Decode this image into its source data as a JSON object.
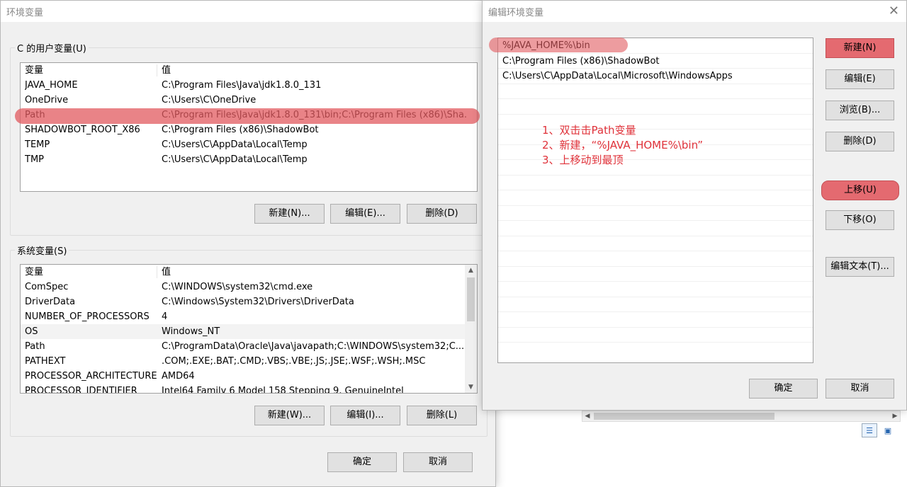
{
  "env_window": {
    "title": "环境变量",
    "user_group_label": "C 的用户变量(U)",
    "system_group_label": "系统变量(S)",
    "col_var": "变量",
    "col_value": "值",
    "user_vars": [
      {
        "name": "JAVA_HOME",
        "value": "C:\\Program Files\\Java\\jdk1.8.0_131"
      },
      {
        "name": "OneDrive",
        "value": "C:\\Users\\C\\OneDrive"
      },
      {
        "name": "Path",
        "value": "C:\\Program Files\\Java\\jdk1.8.0_131\\bin;C:\\Program Files (x86)\\Sha..."
      },
      {
        "name": "SHADOWBOT_ROOT_X86",
        "value": "C:\\Program Files (x86)\\ShadowBot"
      },
      {
        "name": "TEMP",
        "value": "C:\\Users\\C\\AppData\\Local\\Temp"
      },
      {
        "name": "TMP",
        "value": "C:\\Users\\C\\AppData\\Local\\Temp"
      }
    ],
    "system_vars": [
      {
        "name": "ComSpec",
        "value": "C:\\WINDOWS\\system32\\cmd.exe"
      },
      {
        "name": "DriverData",
        "value": "C:\\Windows\\System32\\Drivers\\DriverData"
      },
      {
        "name": "NUMBER_OF_PROCESSORS",
        "value": "4"
      },
      {
        "name": "OS",
        "value": "Windows_NT"
      },
      {
        "name": "Path",
        "value": "C:\\ProgramData\\Oracle\\Java\\javapath;C:\\WINDOWS\\system32;C..."
      },
      {
        "name": "PATHEXT",
        "value": ".COM;.EXE;.BAT;.CMD;.VBS;.VBE;.JS;.JSE;.WSF;.WSH;.MSC"
      },
      {
        "name": "PROCESSOR_ARCHITECTURE",
        "value": "AMD64"
      },
      {
        "name": "PROCESSOR_IDENTIFIER",
        "value": "Intel64 Family 6 Model 158 Stepping 9, GenuineIntel"
      }
    ],
    "user_buttons": {
      "new": "新建(N)...",
      "edit": "编辑(E)...",
      "delete": "删除(D)"
    },
    "system_buttons": {
      "new": "新建(W)...",
      "edit": "编辑(I)...",
      "delete": "删除(L)"
    },
    "ok": "确定",
    "cancel": "取消"
  },
  "edit_window": {
    "title": "编辑环境变量",
    "entries": [
      "%JAVA_HOME%\\bin",
      "C:\\Program Files (x86)\\ShadowBot",
      "C:\\Users\\C\\AppData\\Local\\Microsoft\\WindowsApps"
    ],
    "annotations": [
      "1、双击击Path变量",
      "2、新建，“%JAVA_HOME%\\bin”",
      "3、上移动到最顶"
    ],
    "buttons": {
      "new": "新建(N)",
      "edit": "编辑(E)",
      "browse": "浏览(B)...",
      "delete": "删除(D)",
      "up": "上移(U)",
      "down": "下移(O)",
      "edit_text": "编辑文本(T)..."
    },
    "ok": "确定",
    "cancel": "取消"
  },
  "colors": {
    "highlight": "#e46a70",
    "annotation": "#e0323a"
  }
}
